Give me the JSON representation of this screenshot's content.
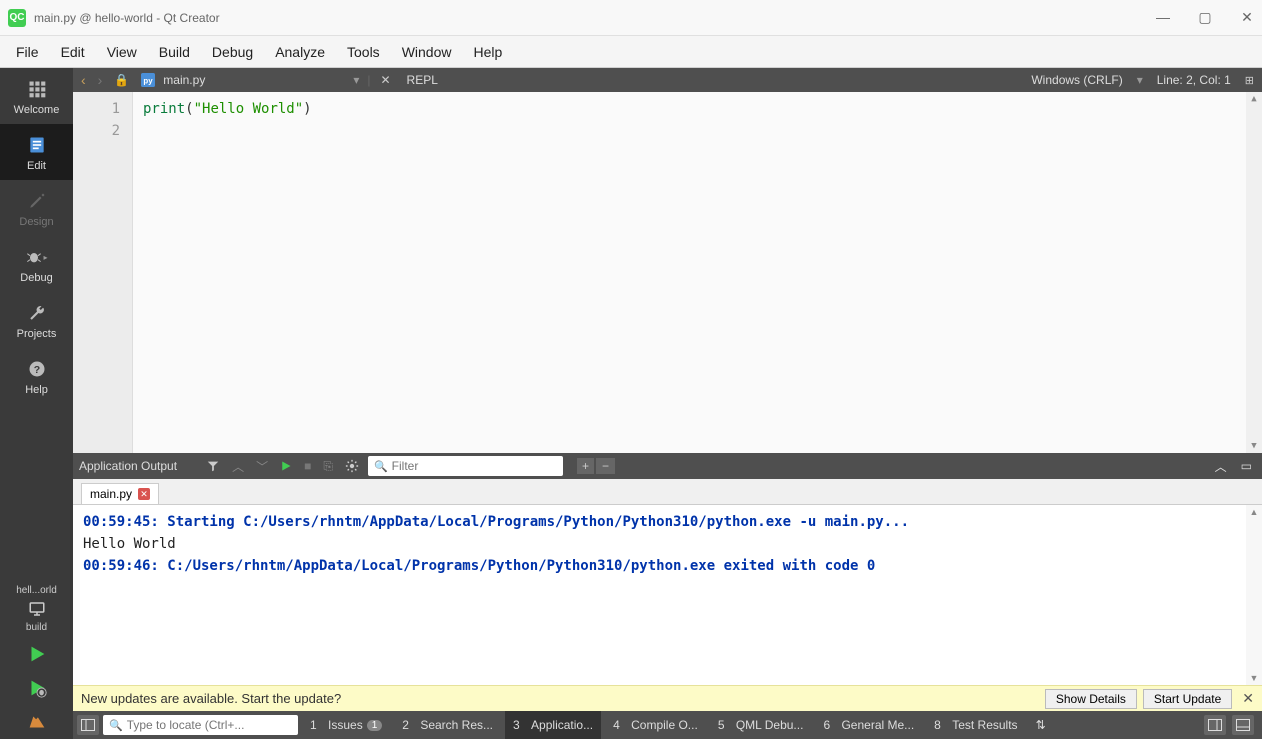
{
  "titlebar": {
    "title": "main.py @ hello-world - Qt Creator",
    "logo": "QC"
  },
  "menubar": [
    "File",
    "Edit",
    "View",
    "Build",
    "Debug",
    "Analyze",
    "Tools",
    "Window",
    "Help"
  ],
  "sidebar": {
    "items": [
      {
        "id": "welcome",
        "label": "Welcome"
      },
      {
        "id": "edit",
        "label": "Edit"
      },
      {
        "id": "design",
        "label": "Design"
      },
      {
        "id": "debug",
        "label": "Debug"
      },
      {
        "id": "projects",
        "label": "Projects"
      },
      {
        "id": "help",
        "label": "Help"
      }
    ],
    "kit_short": "hell...orld",
    "kit_config": "build"
  },
  "editbar": {
    "filename": "main.py",
    "repl": "REPL",
    "encoding": "Windows (CRLF)",
    "cursor": "Line: 2, Col: 1"
  },
  "editor": {
    "lines": [
      "1",
      "2"
    ],
    "code": {
      "fn": "print",
      "lparen": "(",
      "str": "\"Hello World\"",
      "rparen": ")"
    }
  },
  "output_panel": {
    "title": "Application Output",
    "filter_placeholder": "Filter",
    "tab": "main.py",
    "lines": {
      "l1": "00:59:45: Starting C:/Users/rhntm/AppData/Local/Programs/Python/Python310/python.exe -u main.py...",
      "l2": "Hello World",
      "l3": "00:59:46: C:/Users/rhntm/AppData/Local/Programs/Python/Python310/python.exe exited with code 0"
    }
  },
  "notification": {
    "message": "New updates are available. Start the update?",
    "show_details": "Show Details",
    "start_update": "Start Update"
  },
  "statusbar": {
    "locator_placeholder": "Type to locate (Ctrl+...",
    "tabs": [
      {
        "num": "1",
        "label": "Issues",
        "badge": "1"
      },
      {
        "num": "2",
        "label": "Search Res..."
      },
      {
        "num": "3",
        "label": "Applicatio..."
      },
      {
        "num": "4",
        "label": "Compile O..."
      },
      {
        "num": "5",
        "label": "QML Debu..."
      },
      {
        "num": "6",
        "label": "General Me..."
      },
      {
        "num": "8",
        "label": "Test Results"
      }
    ]
  }
}
